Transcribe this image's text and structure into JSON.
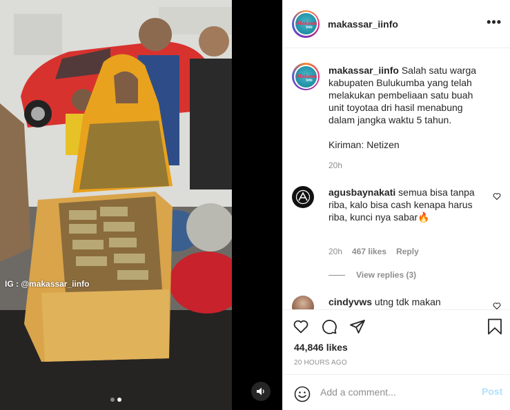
{
  "media": {
    "watermark": "IG : @makassar_iinfo",
    "carousel": {
      "total": 2,
      "active_index": 1
    },
    "audio_icon": "speaker-icon"
  },
  "header": {
    "username": "makassar_iinfo",
    "more_label": "•••"
  },
  "caption": {
    "username": "makassar_iinfo",
    "text": "Salah satu warga kabupaten Bulukumba yang telah melakukan pembeliaan satu buah unit toyotaa dri hasil menabung dalam jangka waktu 5 tahun.",
    "credit": "Kiriman: Netizen",
    "time": "20h"
  },
  "comments": [
    {
      "username": "agusbaynakati",
      "text": "semua bisa tanpa riba, kalo bisa cash kenapa harus riba, kunci nya sabar🔥",
      "time": "20h",
      "likes": "467 likes",
      "reply_label": "Reply",
      "view_replies": "View replies (3)"
    },
    {
      "username": "cindyvws",
      "text": "utng tdk makan"
    }
  ],
  "actions": {
    "icons": [
      "heart-icon",
      "comment-icon",
      "share-icon",
      "bookmark-icon"
    ],
    "likes": "44,846 likes",
    "timestamp": "20 HOURS AGO"
  },
  "add_comment": {
    "placeholder": "Add a comment...",
    "post_label": "Post",
    "emoji_icon": "emoji-icon"
  },
  "colors": {
    "post_button_disabled": "#b2dffc",
    "secondary_text": "#8e8e8e",
    "border": "#efefef"
  }
}
